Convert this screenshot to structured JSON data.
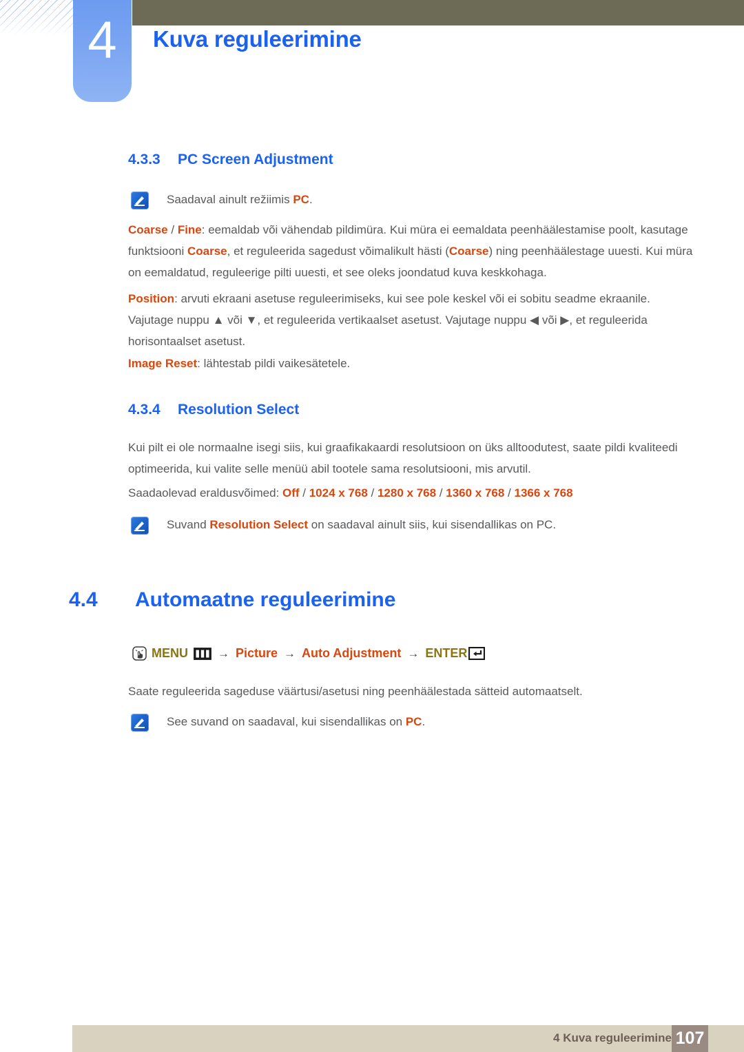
{
  "header": {
    "chapter_number": "4",
    "chapter_title": "Kuva reguleerimine"
  },
  "sections": {
    "s433": {
      "number": "4.3.3",
      "title": "PC Screen Adjustment",
      "note1_pre": "Saadaval ainult režiimis ",
      "note1_hl": "PC",
      "note1_post": ".",
      "p1_a": "Coarse",
      "p1_b": " / ",
      "p1_c": "Fine",
      "p1_d": ": eemaldab või vähendab pildimüra. Kui müra ei eemaldata peenhäälestamise poolt, kasutage funktsiooni ",
      "p1_e": "Coarse",
      "p1_f": ", et reguleerida sagedust võimalikult hästi (",
      "p1_g": "Coarse",
      "p1_h": ") ning peenhäälestage uuesti. Kui müra on eemaldatud, reguleerige pilti uuesti, et see oleks joondatud kuva keskkohaga.",
      "p2_a": "Position",
      "p2_b": ": arvuti ekraani asetuse reguleerimiseks, kui see pole keskel või ei sobitu seadme ekraanile. Vajutage nuppu ▲ või ▼, et reguleerida vertikaalset asetust. Vajutage nuppu ◀ või ▶, et reguleerida horisontaalset asetust.",
      "p3_a": "Image Reset",
      "p3_b": ": lähtestab pildi vaikesätetele."
    },
    "s434": {
      "number": "4.3.4",
      "title": "Resolution Select",
      "p1": "Kui pilt ei ole normaalne isegi siis, kui graafikakaardi resolutsioon on üks alltoodutest, saate pildi kvaliteedi optimeerida, kui valite selle menüü abil tootele sama resolutsiooni, mis arvutil.",
      "p2_label": "Saadaolevad eraldusvõimed: ",
      "p2_options": [
        "Off",
        "1024 x 768",
        "1280 x 768",
        "1360 x 768",
        "1366 x 768"
      ],
      "p2_separator": " / ",
      "note_pre": "Suvand ",
      "note_hl": "Resolution Select",
      "note_post": " on saadaval ainult siis, kui sisendallikas on PC."
    },
    "s44": {
      "number": "4.4",
      "title": "Automaatne reguleerimine",
      "menu_path": {
        "hand_icon": "hand-press-icon",
        "menu_label": "MENU",
        "menu_icon": "menu-button-icon",
        "arrow": "→",
        "item1": "Picture",
        "item2": "Auto Adjustment",
        "enter_label": "ENTER",
        "enter_icon": "enter-key-icon"
      },
      "p1": "Saate reguleerida sageduse väärtusi/asetusi ning peenhäälestada sätteid automaatselt.",
      "note_pre": "See suvand on saadaval, kui sisendallikas on ",
      "note_hl": "PC",
      "note_post": "."
    }
  },
  "footer": {
    "text": "4 Kuva reguleerimine",
    "page": "107"
  },
  "colors": {
    "heading_blue": "#1c62f0",
    "accent_orange": "#d9470f",
    "menu_gold": "#8a7414",
    "olive_bar": "#6d6b56",
    "footer_bar": "#d8d2be",
    "page_box": "#9a8b82"
  }
}
